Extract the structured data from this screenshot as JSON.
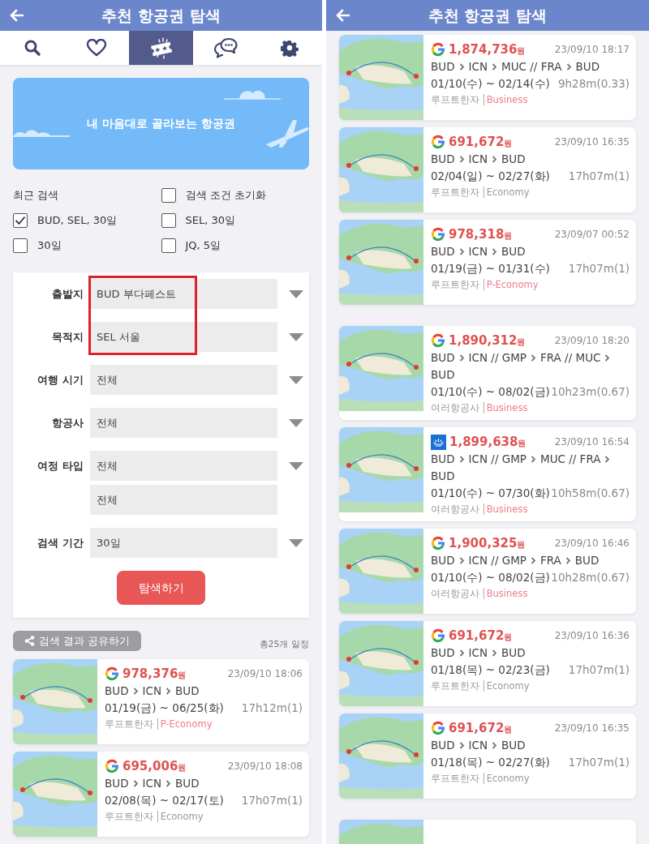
{
  "left_panel": {
    "header": {
      "title": "추천 항공권 탐색"
    },
    "tabs": [
      {
        "selected": false
      },
      {
        "selected": false
      },
      {
        "selected": true
      },
      {
        "selected": false
      },
      {
        "selected": false
      }
    ],
    "banner": {
      "text": "내 마음대로 골라보는 항공권"
    },
    "recent": [
      {
        "kind": "heading",
        "label": "최근 검색"
      },
      {
        "kind": "checkbox",
        "label": "검색 조건 초기화",
        "checked": false
      },
      {
        "kind": "checkbox",
        "label": "BUD, SEL, 30일",
        "checked": true
      },
      {
        "kind": "checkbox",
        "label": "SEL, 30일",
        "checked": false
      },
      {
        "kind": "checkbox",
        "label": "30일",
        "checked": false
      },
      {
        "kind": "checkbox",
        "label": "JQ, 5일",
        "checked": false
      }
    ],
    "form": {
      "fields": [
        {
          "label": "출발지",
          "value": "BUD 부다페스트",
          "dropdown": true,
          "highlighted": true
        },
        {
          "label": "목적지",
          "value": "SEL 서울",
          "dropdown": true,
          "highlighted": true
        },
        {
          "label": "여행 시기",
          "value": "전체",
          "dropdown": true,
          "highlighted": false
        },
        {
          "label": "항공사",
          "value": "전체",
          "dropdown": true,
          "highlighted": false
        },
        {
          "label": "여정 타입",
          "value": "전체",
          "dropdown": true,
          "highlighted": false
        },
        {
          "value": "전체",
          "dropdown": false,
          "highlighted": false
        },
        {
          "label": "검색 기간",
          "value": "30일",
          "dropdown": true,
          "highlighted": false
        }
      ],
      "submit": "탐색하기"
    },
    "share_button": "검색 결과 공유하기",
    "count": "총25개 일정",
    "cards": [
      {
        "kind": "google",
        "price": "978,376",
        "currency": "원",
        "time": "23/09/10 18:06",
        "route": [
          "BUD",
          "ICN",
          "BUD"
        ],
        "dates": "01/19(금) ~ 06/25(화)",
        "duration": "17h12m(1)",
        "airline": "루프트한자",
        "cabin": "P-Economy",
        "cabin_highlighted": true
      },
      {
        "kind": "google",
        "price": "695,006",
        "currency": "원",
        "time": "23/09/10 18:08",
        "route": [
          "BUD",
          "ICN",
          "BUD"
        ],
        "dates": "02/08(목) ~ 02/17(토)",
        "duration": "17h07m(1)",
        "airline": "루프트한자",
        "cabin": "Economy",
        "cabin_highlighted": false
      }
    ]
  },
  "right_panel": {
    "header": {
      "title": "추천 항공권 탐색"
    },
    "groups": [
      [
        {
          "kind": "google",
          "price": "1,874,736",
          "currency": "원",
          "time": "23/09/10 18:17",
          "route": [
            "BUD",
            "ICN",
            "MUC // FRA",
            "BUD"
          ],
          "dates": "01/10(수) ~ 02/14(수)",
          "duration": "9h28m(0.33)",
          "airline": "루프트한자",
          "cabin": "Business",
          "cabin_highlighted": true
        },
        {
          "kind": "google",
          "price": "691,672",
          "currency": "원",
          "time": "23/09/10 16:35",
          "route": [
            "BUD",
            "ICN",
            "BUD"
          ],
          "dates": "02/04(일) ~ 02/27(화)",
          "duration": "17h07m(1)",
          "airline": "루프트한자",
          "cabin": "Economy",
          "cabin_highlighted": false
        },
        {
          "kind": "google",
          "price": "978,318",
          "currency": "원",
          "time": "23/09/07 00:52",
          "route": [
            "BUD",
            "ICN",
            "BUD"
          ],
          "dates": "01/19(금) ~ 01/31(수)",
          "duration": "17h07m(1)",
          "airline": "루프트한자",
          "cabin": "P-Economy",
          "cabin_highlighted": true
        }
      ],
      [
        {
          "kind": "google",
          "price": "1,890,312",
          "currency": "원",
          "time": "23/09/10 18:20",
          "route": [
            "BUD",
            "ICN // GMP",
            "FRA // MUC",
            "BUD"
          ],
          "dates": "01/10(수) ~ 08/02(금)",
          "duration": "10h23m(0.67)",
          "airline": "여러항공사",
          "cabin": "Business",
          "cabin_highlighted": true
        },
        {
          "kind": "other",
          "price": "1,899,638",
          "currency": "원",
          "time": "23/09/10 16:54",
          "route": [
            "BUD",
            "ICN // GMP",
            "MUC // FRA",
            "BUD"
          ],
          "dates": "01/10(수) ~ 07/30(화)",
          "duration": "10h58m(0.67)",
          "airline": "여러항공사",
          "cabin": "Business",
          "cabin_highlighted": true
        },
        {
          "kind": "google",
          "price": "1,900,325",
          "currency": "원",
          "time": "23/09/10 16:46",
          "route": [
            "BUD",
            "ICN // GMP",
            "FRA",
            "BUD"
          ],
          "dates": "01/10(수) ~ 08/02(금)",
          "duration": "10h28m(0.67)",
          "airline": "여러항공사",
          "cabin": "Business",
          "cabin_highlighted": true
        },
        {
          "kind": "google",
          "price": "691,672",
          "currency": "원",
          "time": "23/09/10 16:36",
          "route": [
            "BUD",
            "ICN",
            "BUD"
          ],
          "dates": "01/18(목) ~ 02/23(금)",
          "duration": "17h07m(1)",
          "airline": "루프트한자",
          "cabin": "Economy",
          "cabin_highlighted": false
        },
        {
          "kind": "google",
          "price": "691,672",
          "currency": "원",
          "time": "23/09/10 16:35",
          "route": [
            "BUD",
            "ICN",
            "BUD"
          ],
          "dates": "01/18(목) ~ 02/27(화)",
          "duration": "17h07m(1)",
          "airline": "루프트한자",
          "cabin": "Economy",
          "cabin_highlighted": false
        }
      ]
    ],
    "more_cards_below": true
  }
}
